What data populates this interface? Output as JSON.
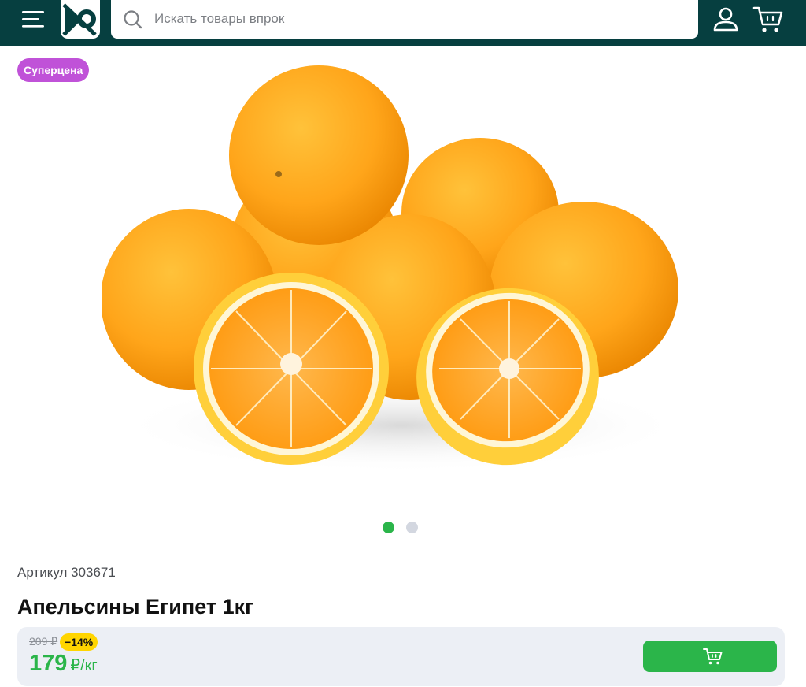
{
  "header": {
    "menu_icon": "hamburger-icon",
    "logo_icon": "store-logo-icon",
    "search_icon": "search-icon",
    "user_icon": "user-icon",
    "cart_icon": "cart-icon",
    "background_color": "#063f40"
  },
  "search": {
    "placeholder": "Искать товары впрок",
    "value": ""
  },
  "product": {
    "badge": "Суперцена",
    "badge_color": "#c052d8",
    "image_icon": "oranges-photo",
    "sku_label": "Артикул 303671",
    "title": "Апельсины Египет 1кг"
  },
  "carousel": {
    "total_slides": 2,
    "active_slide": 1,
    "active_color": "#2bb54a",
    "inactive_color": "#d3d7e0"
  },
  "pricing": {
    "old_price": "209 ₽",
    "discount": "−14%",
    "price": "179",
    "unit": "₽/кг",
    "accent_color": "#2bb54a",
    "add_to_cart_icon": "cart-icon"
  }
}
